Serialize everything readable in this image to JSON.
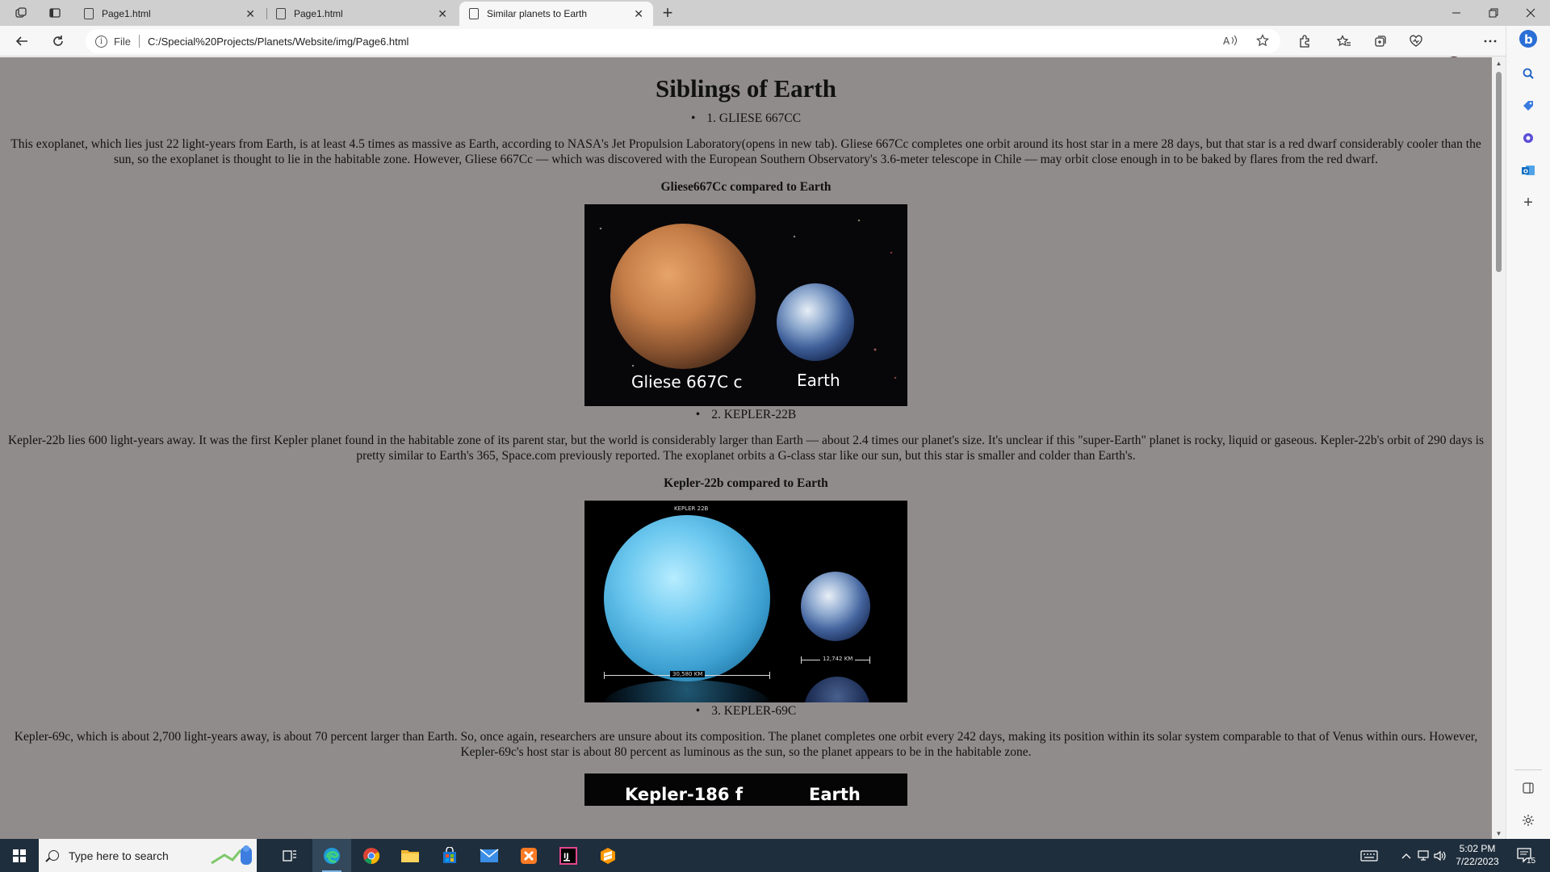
{
  "browser": {
    "tabs": [
      {
        "title": "Page1.html"
      },
      {
        "title": "Page1.html"
      },
      {
        "title": "Similar planets to Earth"
      }
    ],
    "address": {
      "scheme_label": "File",
      "url": "C:/Special%20Projects/Planets/Website/img/Page6.html"
    }
  },
  "page": {
    "heading": "Siblings of Earth",
    "sections": [
      {
        "bullet": "1. GLIESE 667CC",
        "paragraph": "This exoplanet, which lies just 22 light-years from Earth, is at least 4.5 times as massive as Earth, according to NASA's Jet Propulsion Laboratory(opens in new tab). Gliese 667Cc completes one orbit around its host star in a mere 28 days, but that star is a red dwarf considerably cooler than the sun, so the exoplanet is thought to lie in the habitable zone. However, Gliese 667Cc — which was discovered with the European Southern Observatory's 3.6-meter telescope in Chile — may orbit close enough in to be baked by flares from the red dwarf.",
        "caption": "Gliese667Cc compared to Earth",
        "image_labels": {
          "left": "Gliese 667C c",
          "right": "Earth"
        }
      },
      {
        "bullet": "2. KEPLER-22B",
        "paragraph": "Kepler-22b lies 600 light-years away. It was the first Kepler planet found in the habitable zone of its parent star, but the world is considerably larger than Earth — about 2.4 times our planet's size. It's unclear if this \"super-Earth\" planet is rocky, liquid or gaseous. Kepler-22b's orbit of 290 days is pretty similar to Earth's 365, Space.com previously reported. The exoplanet orbits a G-class star like our sun, but this star is smaller and colder than Earth's.",
        "caption": "Kepler-22b compared to Earth",
        "image_labels": {
          "top": "KEPLER 22B",
          "left_scale": "30,580 KM",
          "right_scale": "12,742 KM"
        }
      },
      {
        "bullet": "3. KEPLER-69C",
        "paragraph": "Kepler-69c, which is about 2,700 light-years away, is about 70 percent larger than Earth. So, once again, researchers are unsure about its composition. The planet completes one orbit every 242 days, making its position within its solar system comparable to that of Venus within ours. However, Kepler-69c's host star is about 80 percent as luminous as the sun, so the planet appears to be in the habitable zone.",
        "image_labels": {
          "left": "Kepler-186 f",
          "right": "Earth"
        }
      }
    ]
  },
  "taskbar": {
    "search_placeholder": "Type here to search",
    "time": "5:02 PM",
    "date": "7/22/2023",
    "notification_count": "15"
  }
}
